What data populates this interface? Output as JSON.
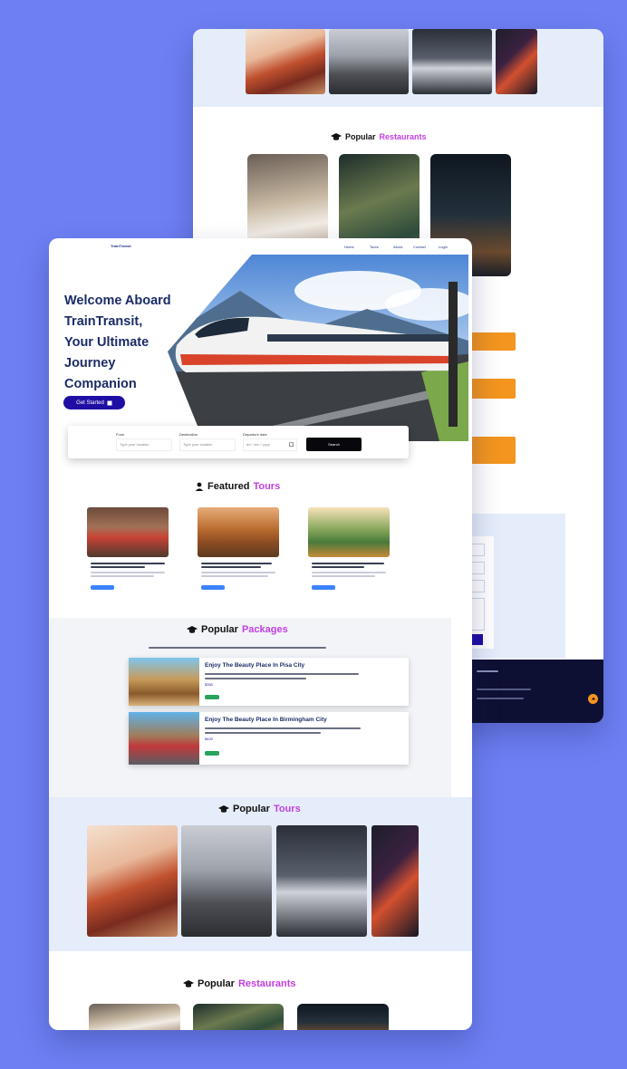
{
  "colors": {
    "background": "#6e7ff3",
    "accent_purple": "#c23fe0",
    "primary_button": "#1f0ea4",
    "orange": "#f3951f",
    "footer": "#0e1033",
    "light_section": "#e5edfb"
  },
  "brand": "TrainTransit",
  "nav": [
    "Home",
    "Tours",
    "About",
    "Contact",
    "Login"
  ],
  "hero": {
    "title_lines": [
      "Welcome Aboard",
      "TrainTransit,",
      "Your Ultimate",
      "Journey",
      "Companion"
    ],
    "cta_label": "Get Started",
    "cta_icon": "arrow-right-icon"
  },
  "search": {
    "fields": [
      {
        "label": "From",
        "placeholder": "Type your location"
      },
      {
        "label": "Destination",
        "placeholder": "Type your location"
      },
      {
        "label": "Departure date",
        "placeholder": "dd / mm / yyyy"
      }
    ],
    "button": "Search"
  },
  "featured": {
    "title_plain": "Featured",
    "title_accent": "Tours",
    "icon": "user-icon"
  },
  "packages": {
    "title_plain": "Popular",
    "title_accent": "Packages",
    "icon": "graduation-cap-icon",
    "items": [
      {
        "title": "Enjoy The Beauty Place In Pisa City",
        "price": "$350"
      },
      {
        "title": "Enjoy The Beauty Place In Birmingham City",
        "price": "$420"
      }
    ]
  },
  "popular_tours": {
    "title_plain": "Popular",
    "title_accent": "Tours"
  },
  "popular_restaurants": {
    "title_plain": "Popular",
    "title_accent": "Restaurants"
  }
}
